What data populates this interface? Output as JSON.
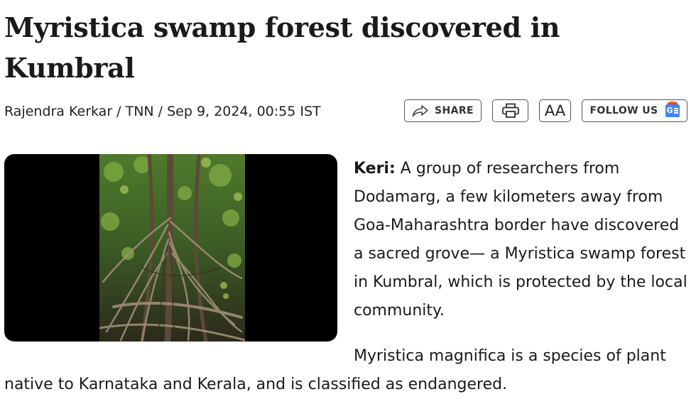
{
  "article": {
    "title": "Myristica swamp forest discovered in Kumbral",
    "byline": "Rajendra Kerkar / TNN / Sep 9, 2024, 00:55 IST",
    "toolbar": {
      "share_label": "SHARE",
      "font_label": "AA",
      "follow_label": "FOLLOW US"
    },
    "lead_dateline": "Keri:",
    "lead_text": " A group of researchers from Dodamarg, a few kilometers away from Goa-Maharashtra border have discovered a sacred grove— a Myristica swamp forest in Kumbral, which is protected by the local community.",
    "para2_line1": "Myristica magnifica is a species of plant",
    "para2_line2": "native to Karnataka and Kerala, and is classified as endangered."
  },
  "icons": {
    "share": "share-arrow-icon",
    "print": "printer-icon",
    "follow": "google-news-icon"
  }
}
